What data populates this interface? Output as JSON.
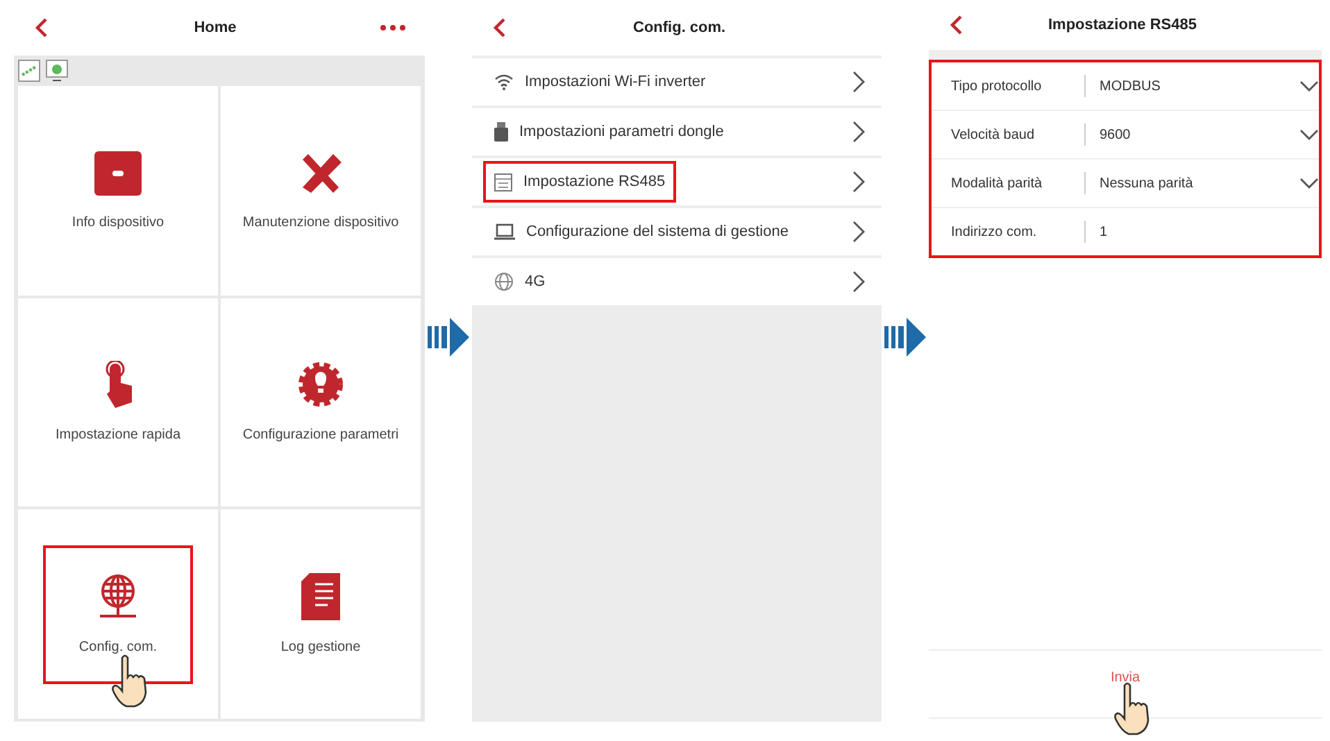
{
  "home": {
    "title": "Home",
    "tiles": [
      {
        "label": "Info dispositivo",
        "highlighted": false
      },
      {
        "label": "Manutenzione dispositivo",
        "highlighted": false
      },
      {
        "label": "Impostazione rapida",
        "highlighted": false
      },
      {
        "label": "Configurazione parametri",
        "highlighted": false
      },
      {
        "label": "Config. com.",
        "highlighted": true
      },
      {
        "label": "Log gestione",
        "highlighted": false
      }
    ]
  },
  "config": {
    "title": "Config. com.",
    "items": [
      {
        "label": "Impostazioni Wi-Fi inverter",
        "highlighted": false
      },
      {
        "label": "Impostazioni parametri dongle",
        "highlighted": false
      },
      {
        "label": "Impostazione RS485",
        "highlighted": true
      },
      {
        "label": "Configurazione del sistema di gestione",
        "highlighted": false
      },
      {
        "label": "4G",
        "highlighted": false
      }
    ]
  },
  "rs485": {
    "title": "Impostazione RS485",
    "highlighted": true,
    "fields": [
      {
        "label": "Tipo protocollo",
        "value": "MODBUS",
        "kind": "dropdown"
      },
      {
        "label": "Velocità baud",
        "value": "9600",
        "kind": "dropdown"
      },
      {
        "label": "Modalità parità",
        "value": "Nessuna parità",
        "kind": "dropdown"
      },
      {
        "label": "Indirizzo com.",
        "value": "1",
        "kind": "text"
      }
    ],
    "submit": "Invia"
  }
}
